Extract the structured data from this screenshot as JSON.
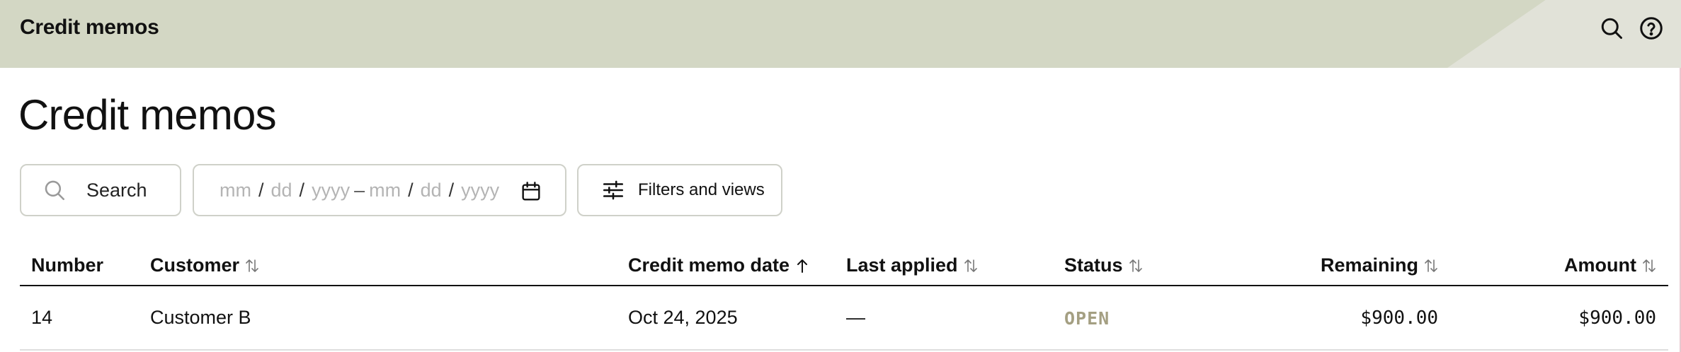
{
  "topbar": {
    "title": "Credit memos",
    "search_icon": "search-icon",
    "help_icon": "help-circle-icon"
  },
  "page": {
    "title": "Credit memos"
  },
  "toolbar": {
    "search_label": "Search",
    "date_range": {
      "from": {
        "mm": "mm",
        "dd": "dd",
        "yyyy": "yyyy"
      },
      "to": {
        "mm": "mm",
        "dd": "dd",
        "yyyy": "yyyy"
      },
      "separator": "/",
      "range_dash": "–",
      "icon": "calendar-icon"
    },
    "filters_label": "Filters and views",
    "filters_icon": "sliders-icon"
  },
  "table": {
    "columns": [
      {
        "label": "Number",
        "sort": "none"
      },
      {
        "label": "Customer",
        "sort": "both"
      },
      {
        "label": "Credit memo date",
        "sort": "asc"
      },
      {
        "label": "Last applied",
        "sort": "both"
      },
      {
        "label": "Status",
        "sort": "both"
      },
      {
        "label": "Remaining",
        "sort": "both"
      },
      {
        "label": "Amount",
        "sort": "both"
      }
    ],
    "rows": [
      {
        "number": "14",
        "customer": "Customer B",
        "credit_memo_date": "Oct 24, 2025",
        "last_applied": "—",
        "status": "OPEN",
        "remaining": "$900.00",
        "amount": "$900.00"
      }
    ]
  },
  "colors": {
    "topbar_bg": "#d3d7c4",
    "status_open": "#a49f82",
    "border": "#cfd1c9"
  }
}
